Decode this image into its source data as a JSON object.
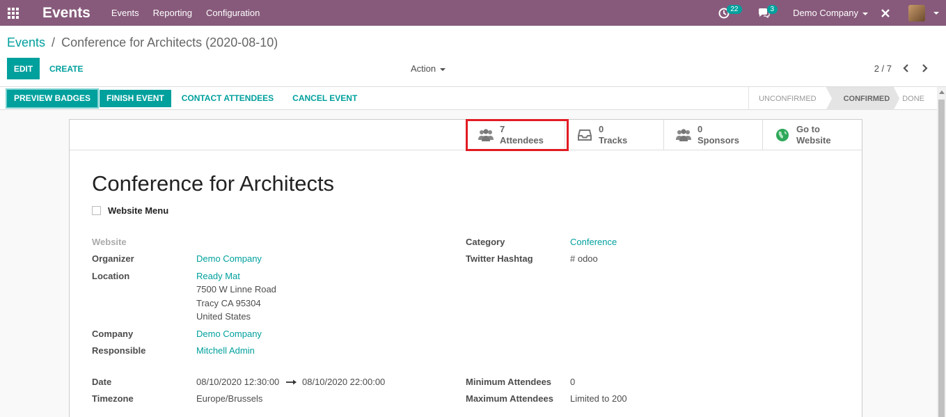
{
  "navbar": {
    "brand": "Events",
    "menu": [
      "Events",
      "Reporting",
      "Configuration"
    ],
    "activity_count": "22",
    "messages_count": "3",
    "company": "Demo Company"
  },
  "breadcrumb": {
    "parent": "Events",
    "separator": "/",
    "current": "Conference for Architects (2020-08-10)"
  },
  "control": {
    "edit_label": "EDIT",
    "create_label": "CREATE",
    "action_label": "Action",
    "pager": "2 / 7"
  },
  "header_buttons": {
    "preview_badges": "PREVIEW BADGES",
    "finish_event": "FINISH EVENT",
    "contact_attendees": "CONTACT ATTENDEES",
    "cancel_event": "CANCEL EVENT"
  },
  "stages": [
    "UNCONFIRMED",
    "CONFIRMED",
    "DONE"
  ],
  "active_stage": "CONFIRMED",
  "smart_buttons": {
    "attendees": {
      "count": "7",
      "label": "Attendees"
    },
    "tracks": {
      "count": "0",
      "label": "Tracks"
    },
    "sponsors": {
      "count": "0",
      "label": "Sponsors"
    },
    "website": {
      "line1": "Go to",
      "line2": "Website"
    }
  },
  "form": {
    "title": "Conference for Architects",
    "website_menu_label": "Website Menu",
    "fields_left": {
      "website_label": "Website",
      "organizer_label": "Organizer",
      "organizer_value": "Demo Company",
      "location_label": "Location",
      "location_name": "Ready Mat",
      "location_street": "7500 W Linne Road",
      "location_city": "Tracy CA 95304",
      "location_country": "United States",
      "company_label": "Company",
      "company_value": "Demo Company",
      "responsible_label": "Responsible",
      "responsible_value": "Mitchell Admin",
      "date_label": "Date",
      "date_start": "08/10/2020 12:30:00",
      "date_end": "08/10/2020 22:00:00",
      "timezone_label": "Timezone",
      "timezone_value": "Europe/Brussels"
    },
    "fields_right": {
      "category_label": "Category",
      "category_value": "Conference",
      "hashtag_label": "Twitter Hashtag",
      "hashtag_value": "# odoo",
      "min_label": "Minimum Attendees",
      "min_value": "0",
      "max_label": "Maximum Attendees",
      "max_value": "Limited to 200"
    }
  },
  "colors": {
    "navbar": "#875a7b",
    "accent": "#00a09d",
    "highlight": "#e21b23"
  }
}
